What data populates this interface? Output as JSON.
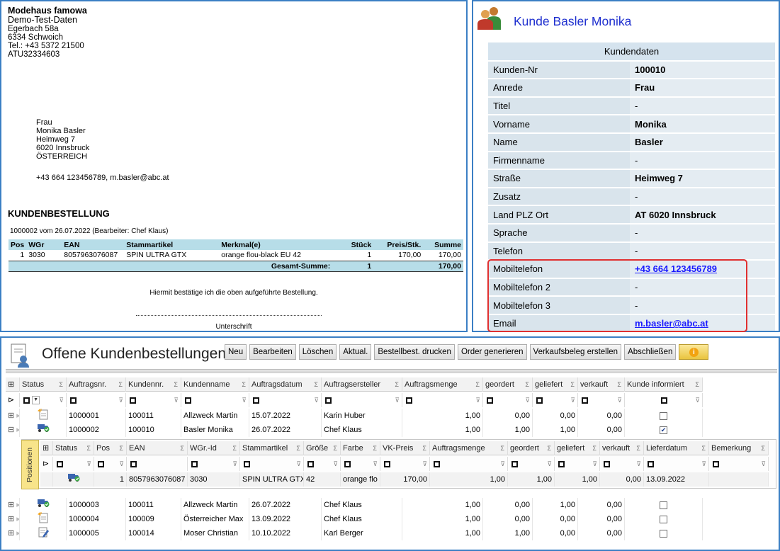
{
  "document": {
    "sender": {
      "company": "Modehaus famowa",
      "subtitle": "Demo-Test-Daten",
      "street": "Egerbach 58a",
      "city": "6334 Schwoich",
      "phone": "Tel.: +43 5372 21500",
      "vat": "ATU32334603"
    },
    "recipient": {
      "salutation": "Frau",
      "name": "Monika Basler",
      "street": "Heimweg 7",
      "city": "6020 Innsbruck",
      "country": "ÖSTERREICH",
      "contact": "+43 664 123456789, m.basler@abc.at"
    },
    "heading": "KUNDENBESTELLUNG",
    "meta": "1000002 vom 26.07.2022 (Bearbeiter: Chef Klaus)",
    "columns": [
      "Pos",
      "WGr",
      "EAN",
      "Stammartikel",
      "Merkmal(e)",
      "Stück",
      "Preis/Stk.",
      "Summe"
    ],
    "rows": [
      [
        "1",
        "3030",
        "8057963076087",
        "SPIN ULTRA GTX",
        "orange flou-black EU 42",
        "1",
        "170,00",
        "170,00"
      ]
    ],
    "total_label": "Gesamt-Summe:",
    "total_qty": "1",
    "total_sum": "170,00",
    "confirm_text": "Hiermit bestätige ich die oben aufgeführte Bestellung.",
    "signature_label": "Unterschrift"
  },
  "customer": {
    "title": "Kunde Basler Monika",
    "table_header": "Kundendaten",
    "fields": [
      {
        "label": "Kunden-Nr",
        "value": "100010"
      },
      {
        "label": "Anrede",
        "value": "Frau"
      },
      {
        "label": "Titel",
        "value": "-"
      },
      {
        "label": "Vorname",
        "value": "Monika"
      },
      {
        "label": "Name",
        "value": "Basler"
      },
      {
        "label": "Firmenname",
        "value": "-"
      },
      {
        "label": "Straße",
        "value": "Heimweg 7"
      },
      {
        "label": "Zusatz",
        "value": "-"
      },
      {
        "label": "Land PLZ Ort",
        "value": "AT 6020 Innsbruck"
      },
      {
        "label": "Sprache",
        "value": "-"
      },
      {
        "label": "Telefon",
        "value": "-"
      },
      {
        "label": "Mobiltelefon",
        "value": "+43 664 123456789"
      },
      {
        "label": "Mobiltelefon 2",
        "value": "-"
      },
      {
        "label": "Mobiltelefon 3",
        "value": "-"
      },
      {
        "label": "Email",
        "value": "m.basler@abc.at"
      }
    ]
  },
  "orders": {
    "title": "Offene Kundenbestellungen",
    "toolbar": {
      "new": "Neu",
      "edit": "Bearbeiten",
      "delete": "Löschen",
      "refresh": "Aktual.",
      "print": "Bestellbest. drucken",
      "generate": "Order generieren",
      "sales": "Verkaufsbeleg erstellen",
      "close": "Abschließen"
    },
    "columns": [
      "Status",
      "Auftragsnr.",
      "Kundennr.",
      "Kundenname",
      "Auftragsdatum",
      "Auftragsersteller",
      "Auftragsmenge",
      "geordert",
      "geliefert",
      "verkauft",
      "Kunde informiert"
    ],
    "rows": [
      {
        "order": "1000001",
        "customer_no": "100011",
        "name": "Allzweck Martin",
        "date": "15.07.2022",
        "creator": "Karin Huber",
        "qty": "1,00",
        "ordered": "0,00",
        "delivered": "0,00",
        "sold": "0,00",
        "informed": false,
        "status_icon": "new-document-icon"
      },
      {
        "order": "1000002",
        "customer_no": "100010",
        "name": "Basler Monika",
        "date": "26.07.2022",
        "creator": "Chef Klaus",
        "qty": "1,00",
        "ordered": "1,00",
        "delivered": "1,00",
        "sold": "0,00",
        "informed": true,
        "status_icon": "delivery-truck-icon"
      },
      {
        "order": "1000003",
        "customer_no": "100011",
        "name": "Allzweck Martin",
        "date": "26.07.2022",
        "creator": "Chef Klaus",
        "qty": "1,00",
        "ordered": "0,00",
        "delivered": "1,00",
        "sold": "0,00",
        "informed": false,
        "status_icon": "delivery-truck-icon"
      },
      {
        "order": "1000004",
        "customer_no": "100009",
        "name": "Österreicher Max",
        "date": "13.09.2022",
        "creator": "Chef Klaus",
        "qty": "1,00",
        "ordered": "0,00",
        "delivered": "0,00",
        "sold": "0,00",
        "informed": false,
        "status_icon": "new-document-icon"
      },
      {
        "order": "1000005",
        "customer_no": "100014",
        "name": "Moser Christian",
        "date": "10.10.2022",
        "creator": "Karl Berger",
        "qty": "1,00",
        "ordered": "1,00",
        "delivered": "0,00",
        "sold": "0,00",
        "informed": false,
        "status_icon": "edit-document-icon"
      }
    ],
    "positions": {
      "tab_label": "Positionen",
      "columns": [
        "Status",
        "Pos",
        "EAN",
        "WGr.-Id",
        "Stammartikel",
        "Größe",
        "Farbe",
        "VK-Preis",
        "Auftragsmenge",
        "geordert",
        "geliefert",
        "verkauft",
        "Lieferdatum",
        "Bemerkung"
      ],
      "row": {
        "pos": "1",
        "ean": "8057963076087",
        "wgr": "3030",
        "article": "SPIN ULTRA GTX",
        "size": "42",
        "color": "orange flo",
        "price": "170,00",
        "qty": "1,00",
        "ordered": "1,00",
        "delivered": "1,00",
        "sold": "0,00",
        "date": "13.09.2022",
        "note": ""
      }
    }
  },
  "colors": {
    "accent": "#3b7fc4",
    "title_blue": "#1e2fcf",
    "highlight": "#e03030",
    "table_header": "#b7dde8"
  }
}
